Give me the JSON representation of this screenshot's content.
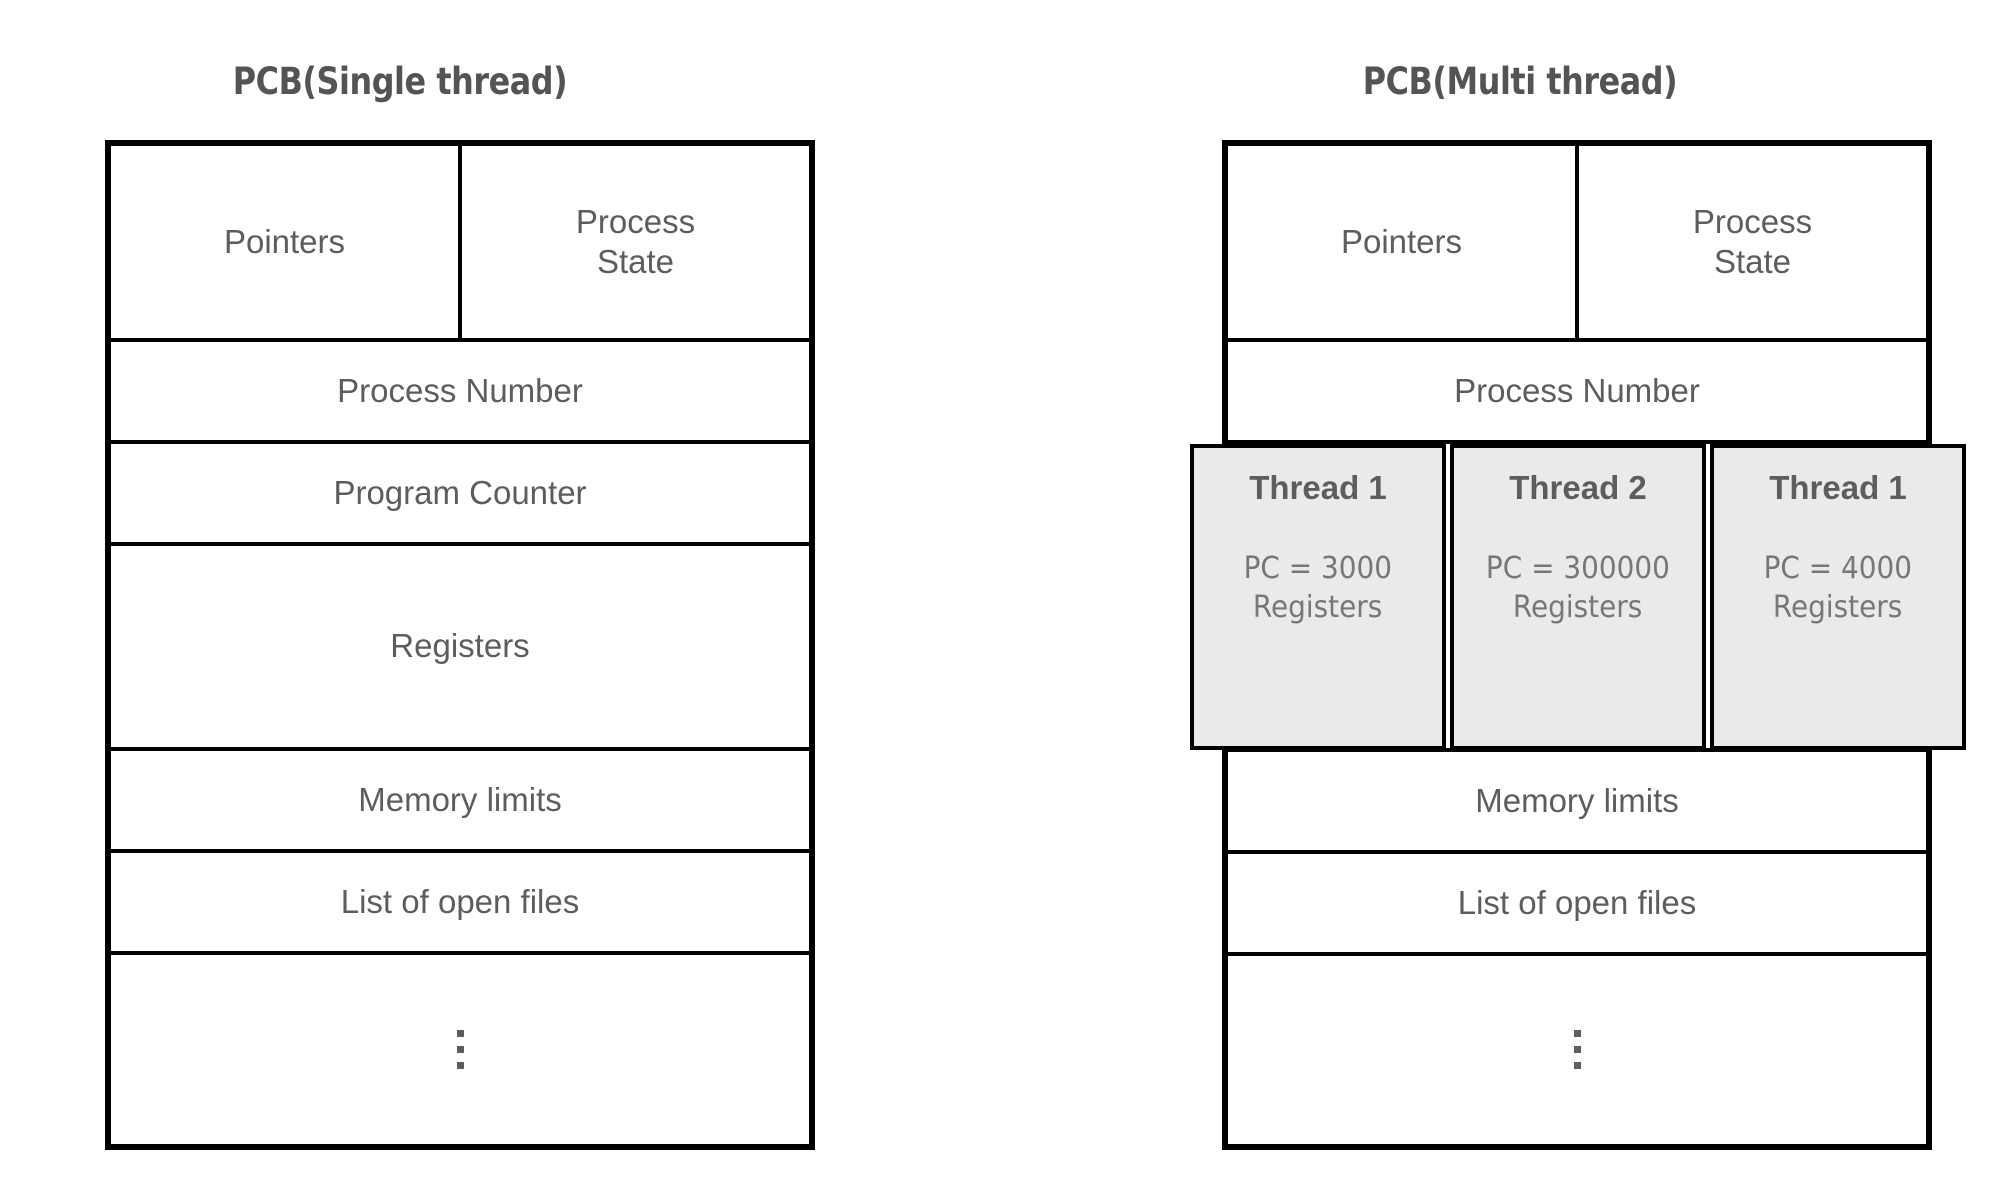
{
  "panels": [
    {
      "title": "PCB(Single thread)",
      "rows": [
        {
          "type": "split",
          "cells": [
            "Pointers",
            "Process\nState"
          ]
        },
        {
          "type": "single",
          "label": "Process Number"
        },
        {
          "type": "single",
          "label": "Program Counter"
        },
        {
          "type": "single",
          "label": "Registers"
        },
        {
          "type": "single",
          "label": "Memory limits"
        },
        {
          "type": "single",
          "label": "List of open files"
        },
        {
          "type": "dots",
          "label": "⋮"
        }
      ]
    },
    {
      "title": "PCB(Multi thread)",
      "rows": [
        {
          "type": "split",
          "cells": [
            "Pointers",
            "Process\nState"
          ]
        },
        {
          "type": "single",
          "label": "Process Number"
        },
        {
          "type": "single",
          "label": ""
        },
        {
          "type": "single",
          "label": "Memory limits"
        },
        {
          "type": "single",
          "label": "List of open files"
        },
        {
          "type": "dots",
          "label": "⋮"
        }
      ],
      "threads": [
        {
          "name": "Thread 1",
          "pc": "PC = 3000",
          "registers": "Registers"
        },
        {
          "name": "Thread 2",
          "pc": "PC = 300000",
          "registers": "Registers"
        },
        {
          "name": "Thread 1",
          "pc": "PC = 4000",
          "registers": "Registers"
        }
      ]
    }
  ],
  "colors": {
    "border": "#000000",
    "text": "#5d5d5d",
    "thread_fill": "#eaeaea",
    "thread_secondary_text": "#777777",
    "background": "#ffffff"
  }
}
